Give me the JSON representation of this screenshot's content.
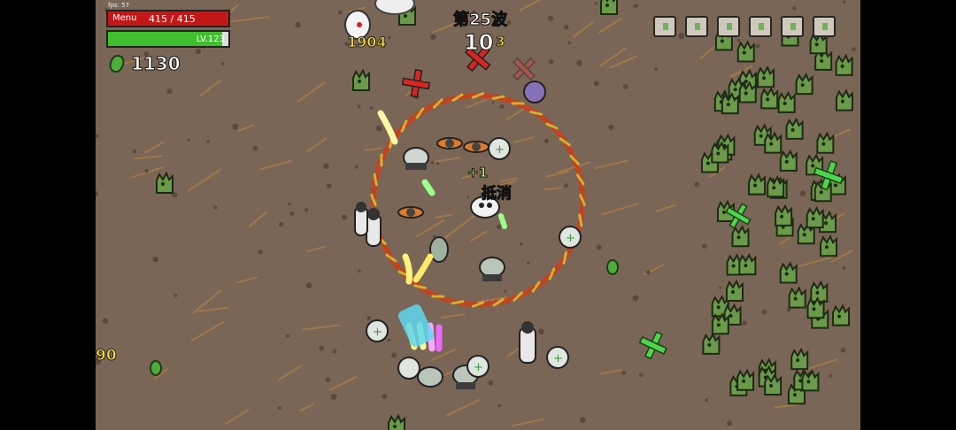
{
  "hud": {
    "fps_label": "fps: 57",
    "menu_label": "Menu",
    "hp_text": "415 / 415",
    "hp_fraction": 1.0,
    "level_text": "LV.123",
    "xp_fraction": 0.95,
    "gem_count": "1130",
    "wave_text": "第25波",
    "timer": "10"
  },
  "floating_text": {
    "damage_1": "1904",
    "damage_2": "3",
    "damage_3": "90",
    "gain": "+1",
    "cancel": "抵消"
  },
  "colors": {
    "ground": "#7a6656",
    "enemy": "#6b9a4a",
    "ring": "#c8401c",
    "hp": "#c41818",
    "xp": "#3fbf2d"
  },
  "chest_count": 6
}
